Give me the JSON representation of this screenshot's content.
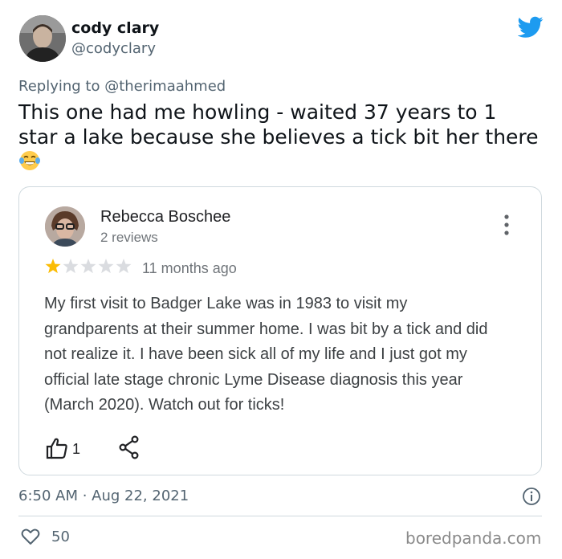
{
  "tweet": {
    "author_name": "cody clary",
    "author_handle": "@codyclary",
    "replying_prefix": "Replying to",
    "replying_mention": "@therimaahmed",
    "text": "This one had me howling - waited 37 years to 1 star a lake because she believes a tick bit her there",
    "emoji_icon": "face-with-tears-of-joy-icon",
    "timestamp": "6:50 AM · Aug 22, 2021",
    "like_count": "50",
    "brand_color": "#1d9bf0"
  },
  "review": {
    "reviewer_name": "Rebecca Boschee",
    "reviewer_meta": "2 reviews",
    "rating": 1,
    "rating_max": 5,
    "star_color": "#fbbc04",
    "empty_star_color": "#dadce0",
    "date": "11 months ago",
    "body": "My first visit to Badger Lake was in 1983 to visit my grandparents at their summer home.  I was bit by a tick and did not realize it.  I have been sick all of my life and I just got my official late stage chronic Lyme Disease diagnosis this year (March 2020). Watch out for ticks!",
    "helpful_count": "1"
  },
  "watermark": "boredpanda.com"
}
